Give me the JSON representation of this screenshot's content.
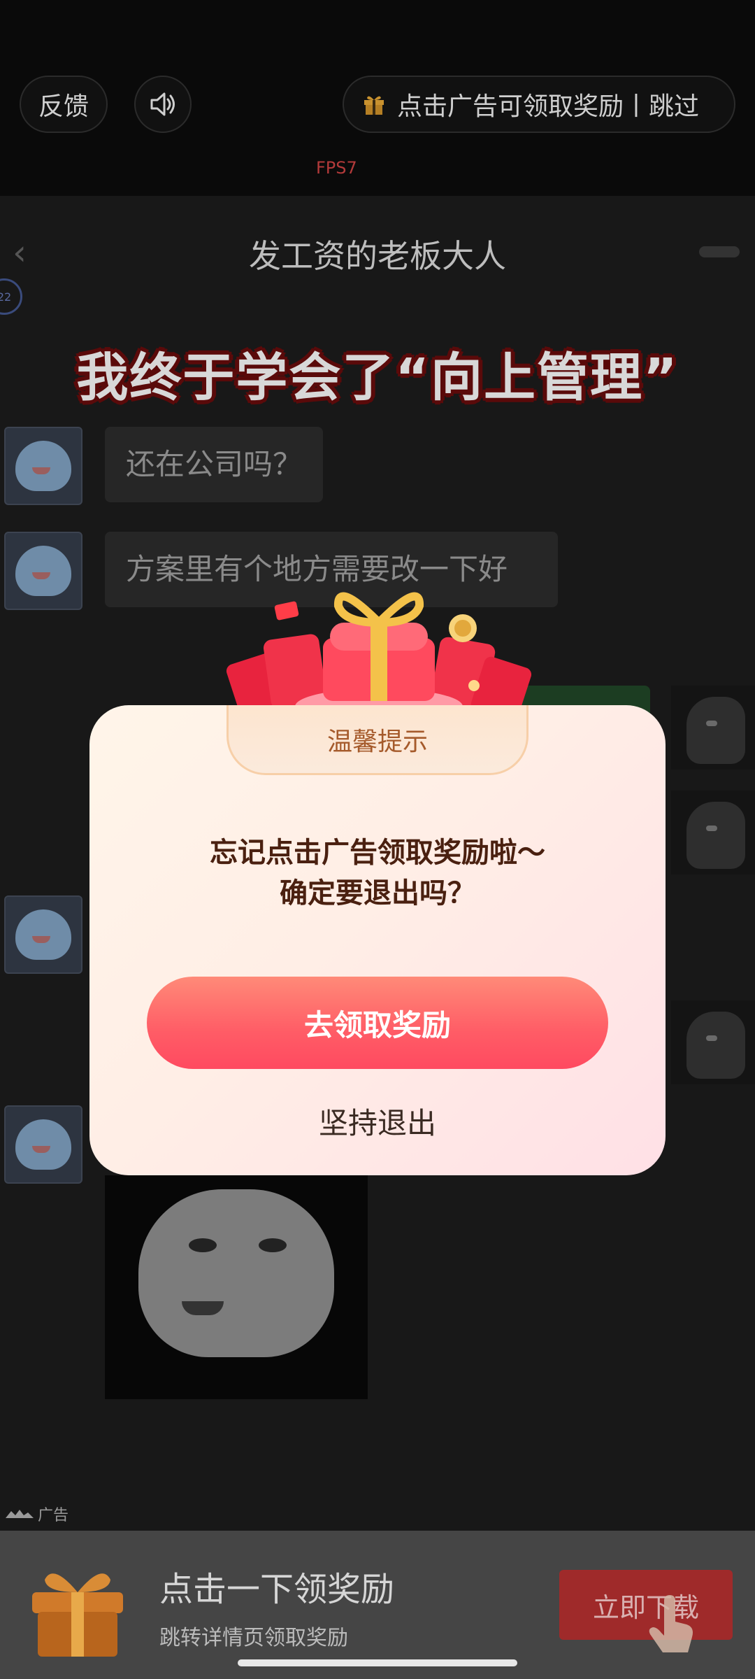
{
  "top_bar": {
    "feedback_label": "反馈",
    "reward_skip_label": "点击广告可领取奖励丨跳过",
    "fps_label": "FPS7"
  },
  "video": {
    "chat_title": "发工资的老板大人",
    "caption": "我终于学会了“向上管理”",
    "messages": [
      {
        "text": "还在公司吗？"
      },
      {
        "text": "方案里有个地方需要改一下好"
      }
    ]
  },
  "dialog": {
    "title": "温馨提示",
    "message_line1": "忘记点击广告领取奖励啦～",
    "message_line2": "确定要退出吗？",
    "claim_label": "去领取奖励",
    "exit_label": "坚持退出"
  },
  "ad_banner": {
    "ad_tag": "广告",
    "title": "点击一下领奖励",
    "subtitle": "跳转详情页领取奖励",
    "button_label": "立即下载"
  },
  "colors": {
    "accent_red": "#ff5c66",
    "dialog_title_color": "#a55a2b"
  }
}
